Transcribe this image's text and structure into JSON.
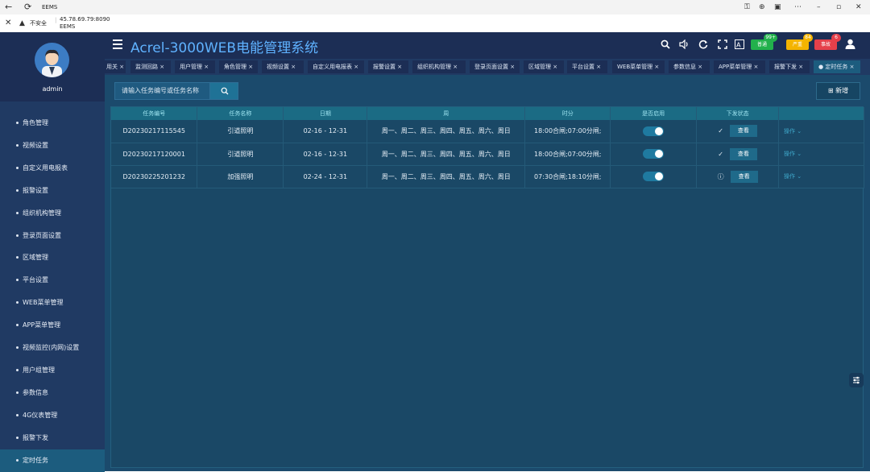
{
  "browser": {
    "tab_title": "EEMS",
    "security_label": "不安全",
    "url": "45.78.69.79:8090",
    "page_label": "EEMS"
  },
  "app": {
    "title": "Acrel-3000WEB电能管理系统"
  },
  "user": {
    "name": "admin"
  },
  "header": {
    "badges": [
      {
        "label": "普通",
        "count": "99+",
        "color": "#22b14c"
      },
      {
        "label": "严重",
        "count": "84",
        "color": "#f4b400"
      },
      {
        "label": "事故",
        "count": "6",
        "color": "#e5404a"
      }
    ]
  },
  "sidebar": {
    "items": [
      {
        "label": "角色管理"
      },
      {
        "label": "视频设置"
      },
      {
        "label": "自定义用电报表"
      },
      {
        "label": "报警设置"
      },
      {
        "label": "组织机构管理"
      },
      {
        "label": "登录页面设置"
      },
      {
        "label": "区域管理"
      },
      {
        "label": "平台设置"
      },
      {
        "label": "WEB菜单管理"
      },
      {
        "label": "APP菜单管理"
      },
      {
        "label": "视频监控(内网)设置"
      },
      {
        "label": "用户组管理"
      },
      {
        "label": "参数信息"
      },
      {
        "label": "4G仪表管理"
      },
      {
        "label": "报警下发"
      },
      {
        "label": "定时任务"
      }
    ]
  },
  "tabs": [
    {
      "label": "用关"
    },
    {
      "label": "监测回路"
    },
    {
      "label": "用户管理"
    },
    {
      "label": "角色管理"
    },
    {
      "label": "视频设置"
    },
    {
      "label": "自定义用电报表"
    },
    {
      "label": "报警设置"
    },
    {
      "label": "组织机构管理"
    },
    {
      "label": "登录页面设置"
    },
    {
      "label": "区域管理"
    },
    {
      "label": "平台设置"
    },
    {
      "label": "WEB菜单管理"
    },
    {
      "label": "参数信息"
    },
    {
      "label": "APP菜单管理"
    },
    {
      "label": "报警下发"
    },
    {
      "label": "定时任务"
    }
  ],
  "toolbar": {
    "search_placeholder": "请输入任务编号或任务名称",
    "add_label": "新增"
  },
  "table": {
    "columns": [
      "任务编号",
      "任务名称",
      "日期",
      "周",
      "时分",
      "是否启用",
      "下发状态",
      ""
    ],
    "view_label": "查看",
    "op_label": "操作",
    "rows": [
      {
        "id": "D20230217115545",
        "name": "引道照明",
        "date": "02-16 - 12-31",
        "week": "周一、周二、周三、周四、周五、周六、周日",
        "time": "18:00合闸;07:00分闸;",
        "status_icon": "check-icon"
      },
      {
        "id": "D20230217120001",
        "name": "引道照明",
        "date": "02-16 - 12-31",
        "week": "周一、周二、周三、周四、周五、周六、周日",
        "time": "18:00合闸;07:00分闸;",
        "status_icon": "check-icon"
      },
      {
        "id": "D20230225201232",
        "name": "加强照明",
        "date": "02-24 - 12-31",
        "week": "周一、周二、周三、周四、周五、周六、周日",
        "time": "07:30合闸;18:10分闸;",
        "status_icon": "info-icon"
      }
    ]
  }
}
